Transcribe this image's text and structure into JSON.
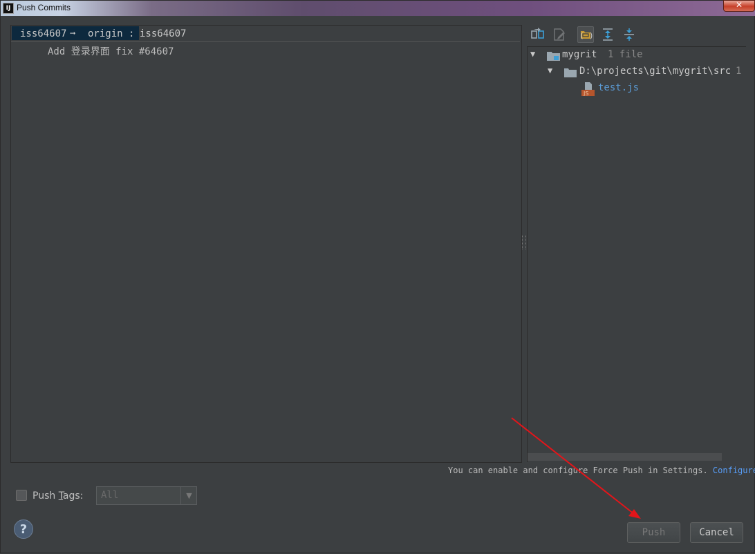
{
  "window": {
    "app_icon": "IJ",
    "title": "Push Commits",
    "close_label": "✕"
  },
  "commits": {
    "local_branch": "iss64607",
    "arrow": "➞",
    "remote": "origin :",
    "target_branch": "iss64607",
    "commit_message": "Add 登录界面 fix #64607"
  },
  "toolbar": {
    "icons": [
      "show-diff-icon",
      "edit-source-icon",
      "group-by-directory-icon",
      "expand-all-icon",
      "collapse-all-icon"
    ]
  },
  "tree": {
    "root_name": "mygrit",
    "root_count": "1 file",
    "folder_path": "D:\\projects\\git\\mygrit\\src",
    "folder_count": "1",
    "file_name": "test.js",
    "file_badge": "JS"
  },
  "info": {
    "text": "You can enable and configure Force Push in Settings.",
    "link": "Configure"
  },
  "tags": {
    "checkbox_label_prefix": "Push ",
    "checkbox_label_mnemonic": "T",
    "checkbox_label_suffix": "ags:",
    "select_value": "All"
  },
  "buttons": {
    "help": "?",
    "push": "Push",
    "cancel": "Cancel"
  },
  "colors": {
    "background": "#3c3f41",
    "selection": "#0d293e",
    "link": "#589df6",
    "annotation_arrow": "#e3151a"
  }
}
